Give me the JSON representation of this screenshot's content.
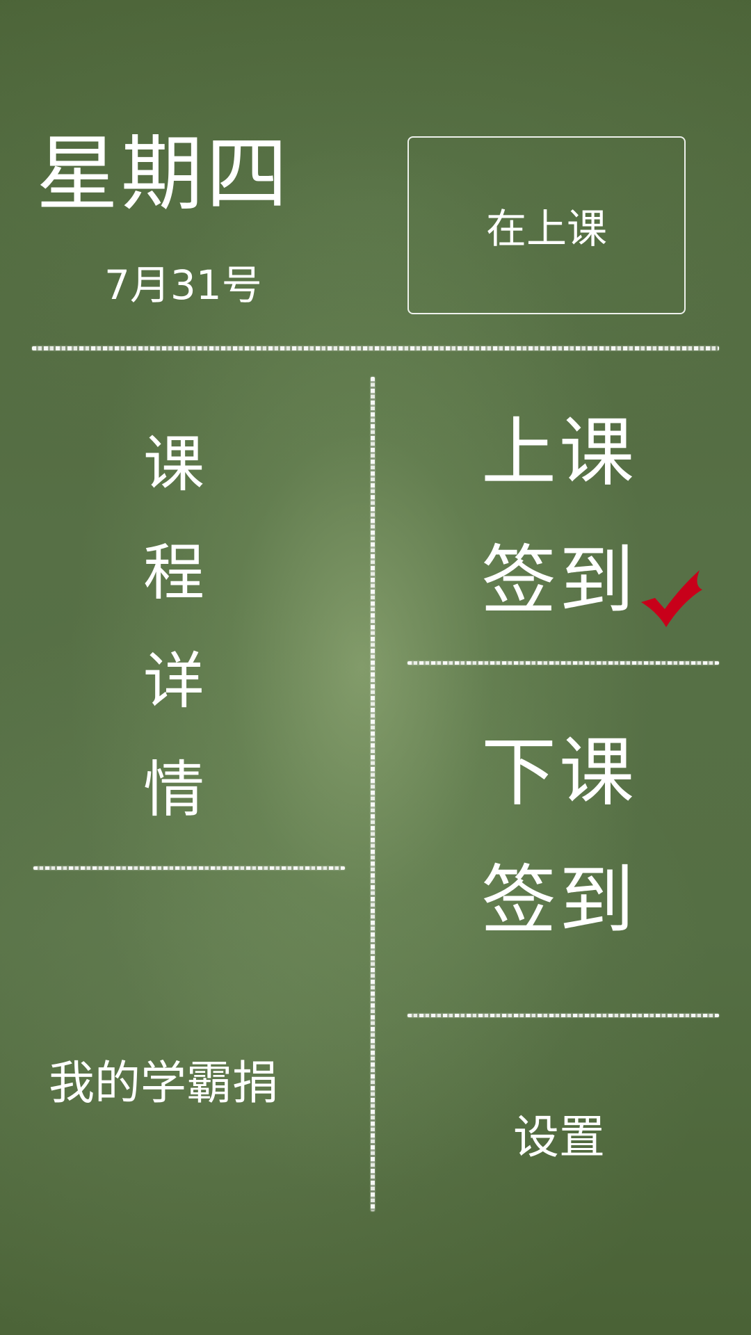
{
  "header": {
    "weekday": "星期四",
    "date": "7月31号",
    "status": "在上课"
  },
  "left_panel": {
    "course_detail_chars": [
      "课",
      "程",
      "详",
      "情"
    ],
    "donate_label": "我的学霸捐"
  },
  "right_panel": {
    "checkin_start": [
      "上课",
      "签到"
    ],
    "checkin_start_done": true,
    "checkin_end": [
      "下课",
      "签到"
    ],
    "settings_label": "设置"
  },
  "colors": {
    "chalkboard": "#556f44",
    "chalk": "#ffffff",
    "check_mark": "#c8001a"
  }
}
